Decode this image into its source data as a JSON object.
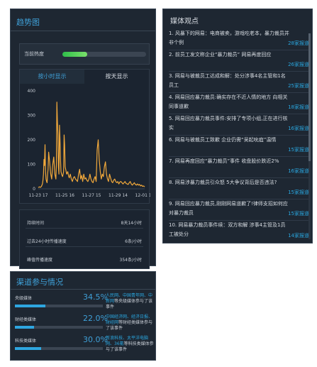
{
  "trend": {
    "title": "趋势图",
    "heat_label": "当前热度",
    "heat_level": 0.3,
    "tabs": [
      {
        "label": "按小时显示",
        "active": true
      },
      {
        "label": "按天显示",
        "active": false
      }
    ],
    "stats": [
      {
        "label": "持续时间",
        "value": "8天14小时"
      },
      {
        "label": "过去24小时传播速度",
        "value": "6条/小时"
      },
      {
        "label": "峰值传播速度",
        "value": "354条/小时"
      }
    ]
  },
  "chart_data": {
    "type": "area",
    "x_tick_labels": [
      "11-23 17",
      "11-25 16",
      "11-27 15",
      "11-29 14",
      "12-01 13"
    ],
    "y_tick_labels": [
      "0",
      "100",
      "200",
      "300",
      "400"
    ],
    "ylim": [
      0,
      400
    ],
    "series": [
      {
        "x": [
          0,
          2,
          4,
          6,
          8,
          9,
          10,
          11,
          12,
          13,
          14,
          15,
          16,
          17,
          18,
          19,
          20,
          22,
          24,
          26,
          28,
          30,
          32,
          34,
          35,
          36,
          37,
          38,
          39,
          40,
          41,
          42,
          43,
          44,
          45,
          46,
          47,
          48,
          49,
          50,
          51,
          52,
          53,
          54,
          55,
          56,
          57,
          58,
          59,
          60,
          62,
          64,
          66,
          68,
          70,
          72,
          74,
          76,
          78,
          80,
          82,
          84,
          86,
          88,
          90,
          92,
          94,
          96,
          98,
          100,
          102,
          104,
          106,
          108,
          110,
          112,
          114,
          116,
          118,
          120,
          122,
          124,
          126,
          128,
          130,
          132,
          134,
          136,
          138,
          140,
          142,
          144,
          146,
          148,
          150,
          152,
          154,
          156,
          158,
          160,
          162,
          164,
          166,
          168,
          170,
          172,
          174,
          176,
          178,
          180,
          182,
          184,
          186,
          188,
          190,
          192,
          194,
          196,
          198,
          200,
          202,
          204,
          206
        ],
        "values": [
          5,
          8,
          6,
          10,
          20,
          35,
          60,
          120,
          95,
          180,
          70,
          40,
          30,
          25,
          60,
          80,
          150,
          110,
          60,
          40,
          100,
          130,
          60,
          40,
          100,
          354,
          280,
          220,
          90,
          60,
          260,
          200,
          120,
          70,
          60,
          55,
          50,
          60,
          70,
          220,
          180,
          90,
          80,
          70,
          60,
          65,
          70,
          60,
          50,
          45,
          60,
          40,
          30,
          45,
          50,
          40,
          35,
          30,
          60,
          80,
          40,
          55,
          30,
          60,
          40,
          45,
          35,
          30,
          40,
          60,
          40,
          30,
          25,
          40,
          50,
          30,
          160,
          200,
          120,
          70,
          40,
          60,
          50,
          90,
          110,
          60,
          40,
          30,
          60,
          45,
          30,
          25,
          35,
          40,
          30,
          25,
          30,
          20,
          28,
          30,
          25,
          20,
          25,
          30,
          22,
          20,
          18,
          25,
          30,
          20,
          15,
          20,
          25,
          18,
          15,
          20,
          15,
          18,
          12,
          15,
          10,
          12,
          8
        ]
      }
    ],
    "line_color": "#f2a93b"
  },
  "channels": {
    "title": "渠道参与情况",
    "items": [
      {
        "name": "央级媒体",
        "pct": "34.5%",
        "level": 0.345,
        "desc_hl": "人民网、中国青年网、中新网",
        "desc_rest": "等央级媒体参与了该事件"
      },
      {
        "name": "财经类媒体",
        "pct": "22.0%",
        "level": 0.22,
        "desc_hl": "中国经济网、经济日报、财经网",
        "desc_rest": "等财经类媒体参与了该事件"
      },
      {
        "name": "科技类媒体",
        "pct": "30.0%",
        "level": 0.3,
        "desc_hl": "新浪科技、太平洋电脑网、36氪",
        "desc_rest": "等科技类媒体参与了该事件"
      }
    ]
  },
  "media": {
    "title": "媒体观点",
    "items": [
      {
        "text": "1. 风暴下的网易：电商被卖，游戏吃老本，暴力裁员并非个例",
        "count": "28家报道"
      },
      {
        "text": "2. 前员工发文称企业“暴力裁员” 网易再度回应",
        "count": "26家报道"
      },
      {
        "text": "3. 网易与被裁员工达成和解：处分涉事4名主管和1名员工",
        "count": "25家报道"
      },
      {
        "text": "4. 网易回应暴力裁员:确实存在不近人情的地方 向相关同事道歉",
        "count": "18家报道"
      },
      {
        "text": "5. 网易回应暴力裁员事件:安排了专项小组,正在进行核实",
        "count": "16家报道"
      },
      {
        "text": "6. 网易与被裁员工致歉 企业仍需“吴起吮疽”温情",
        "count": "15家报道"
      },
      {
        "text": "7. 网易再度回应“暴力裁员”事件 收盘股价跌近2%",
        "count": "16家报道"
      },
      {
        "text": "8. 网易涉暴力裁员引众怒 5大争议背后是否违法?",
        "count": "15家报道"
      },
      {
        "text": "9. 网易回应暴力裁员,刚刚网易道歉了!律师支招如何应对暴力裁员",
        "count": "15家报道"
      },
      {
        "text": "10. 网易暴力裁员事件续：双方和解 涉事4主管及1员工被处分",
        "count": "14家报道"
      }
    ]
  }
}
